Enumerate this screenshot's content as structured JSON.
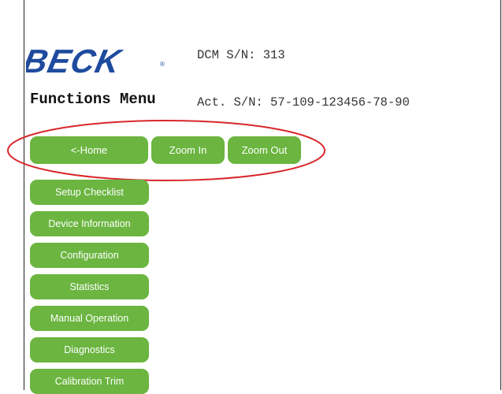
{
  "header": {
    "dcm_serial": "DCM S/N: 313",
    "actuator_serial": "Act. S/N: 57-109-123456-78-90",
    "logo_text": "BECK",
    "logo_mark": "®"
  },
  "page": {
    "title": "Functions Menu"
  },
  "nav": {
    "home_label": "<-Home",
    "zoom_in_label": "Zoom In",
    "zoom_out_label": "Zoom Out"
  },
  "menu": {
    "items": [
      "Setup Checklist",
      "Device Information",
      "Configuration",
      "Statistics",
      "Manual Operation",
      "Diagnostics",
      "Calibration Trim"
    ]
  },
  "colors": {
    "button_green": "#6bb540",
    "logo_blue": "#1f4b9e",
    "highlight_red": "#d9262a"
  }
}
